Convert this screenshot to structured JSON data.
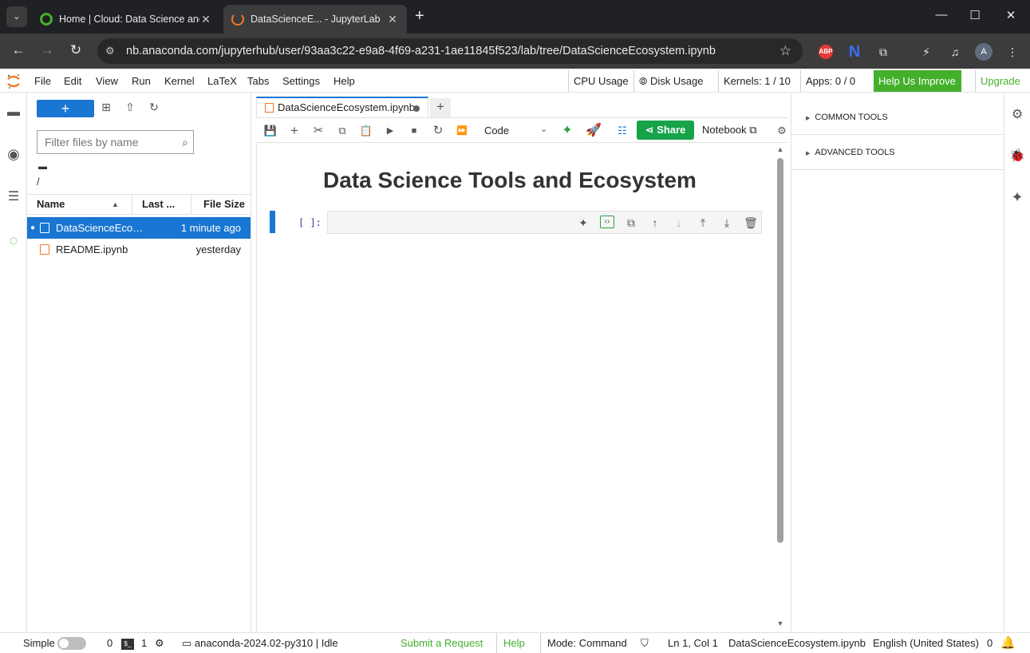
{
  "browser": {
    "tabs": [
      {
        "title": "Home | Cloud: Data Science and AI"
      },
      {
        "title": "DataScienceE... - JupyterLab"
      }
    ],
    "url": "nb.anaconda.com/jupyterhub/user/93aa3c22-e9a8-4f69-a231-1ae11845f523/lab/tree/DataScienceEcosystem.ipynb",
    "extensions": {
      "abp": "ABP",
      "n": "N",
      "avatar": "A"
    }
  },
  "menubar": {
    "items": [
      "File",
      "Edit",
      "View",
      "Run",
      "Kernel",
      "LaTeX",
      "Tabs",
      "Settings",
      "Help"
    ],
    "cpu": "CPU Usage",
    "disk": "Disk Usage",
    "kernels": "Kernels: 1 / 10",
    "apps": "Apps: 0 / 0",
    "help_improve": "Help Us Improve",
    "upgrade": "Upgrade"
  },
  "filebrowser": {
    "new_label": "+",
    "filter_placeholder": "Filter files by name",
    "path": "/",
    "columns": {
      "name": "Name",
      "modified": "Last ...",
      "size": "File Size"
    },
    "files": [
      {
        "name": "DataScienceEcos...",
        "modified": "1 minute ago",
        "selected": true
      },
      {
        "name": "README.ipynb",
        "modified": "yesterday",
        "selected": false
      }
    ]
  },
  "notebook": {
    "tab_title": "DataScienceEcosystem.ipynb",
    "cell_type": "Code",
    "share_label": "Share",
    "kernel_label": "Notebook",
    "heading": "Data Science Tools and Ecosystem",
    "prompt": "[ ]:"
  },
  "rightpanel": {
    "sections": [
      "COMMON TOOLS",
      "ADVANCED TOOLS"
    ]
  },
  "statusbar": {
    "simple": "Simple",
    "terminals": "0",
    "kernels_count": "1",
    "env": "anaconda-2024.02-py310 | Idle",
    "submit": "Submit a Request",
    "help": "Help",
    "mode": "Mode: Command",
    "position": "Ln 1, Col 1",
    "filename": "DataScienceEcosystem.ipynb",
    "language": "English (United States)",
    "notifications": "0"
  },
  "colors": {
    "accent": "#1976d2",
    "anaconda_green": "#43b02a",
    "share_green": "#16a34a",
    "jupyter_orange": "#f37726"
  }
}
